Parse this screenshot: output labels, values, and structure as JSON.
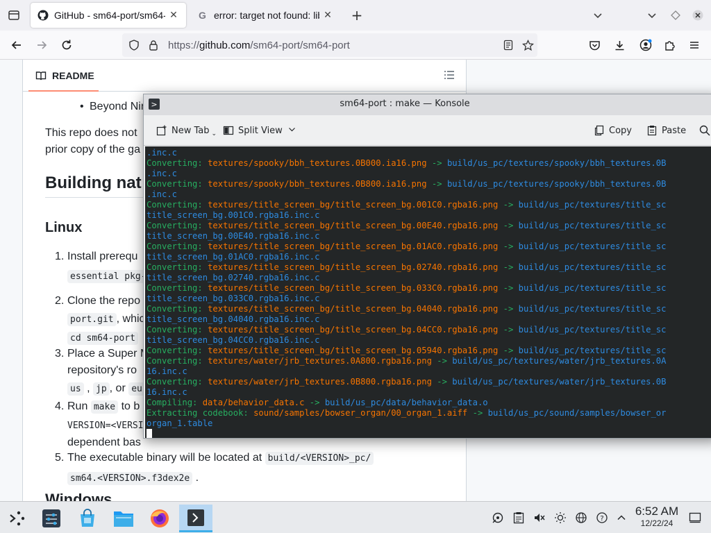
{
  "browser": {
    "tabs": [
      {
        "title": "GitHub - sm64-port/sm64-",
        "active": true,
        "favicon": "github-icon"
      },
      {
        "title": "error: target not found: lib",
        "active": false,
        "favicon": "google-icon"
      }
    ],
    "url_prefix": "https://",
    "url_host": "github.com",
    "url_path": "/sm64-port/sm64-port"
  },
  "readme": {
    "tab_label": "README",
    "bullet_item": "Beyond Ninten",
    "paragraph_line1": "This repo does not",
    "paragraph_line2": "prior copy of the ga",
    "heading_building": "Building nat",
    "heading_linux": "Linux",
    "list": [
      {
        "num": "1.",
        "line1": "Install prerequ",
        "code1": "essential pkg-"
      },
      {
        "num": "2.",
        "line1": "Clone the repo",
        "code1": "port.git",
        "line2_tail": ", whic",
        "code2": "cd sm64-port"
      },
      {
        "num": "3.",
        "line1": "Place a Super M",
        "line2": "repository's ro",
        "code_us": "us",
        "code_jp": "jp",
        "or_text": ", or",
        "code_eu": "eu"
      },
      {
        "num": "4.",
        "line1_pre": "Run",
        "code_make": "make",
        "line1_post": "to b",
        "code_ver": "VERSION=<VERSI",
        "line3": "dependent bas"
      },
      {
        "num": "5.",
        "line1": "The executable binary will be located at",
        "code_path1": "build/<VERSION>_pc/",
        "code_path2": "sm64.<VERSION>.f3dex2e",
        "period": "."
      }
    ],
    "heading_windows": "Windows"
  },
  "konsole": {
    "window_title": "sm64-port : make — Konsole",
    "toolbar": {
      "new_tab": "New Tab",
      "split_view": "Split View",
      "copy": "Copy",
      "paste": "Paste"
    },
    "lines": [
      [
        {
          "t": ".inc.c",
          "c": "blue"
        }
      ],
      [
        {
          "t": "Converting: ",
          "c": "green"
        },
        {
          "t": "textures/spooky/bbh_textures.0B000.ia16.png",
          "c": "orange"
        },
        {
          "t": " -> ",
          "c": "green"
        },
        {
          "t": "build/us_pc/textures/spooky/bbh_textures.0B",
          "c": "blue"
        }
      ],
      [
        {
          "t": ".inc.c",
          "c": "blue"
        }
      ],
      [
        {
          "t": "Converting: ",
          "c": "green"
        },
        {
          "t": "textures/spooky/bbh_textures.0B800.ia16.png",
          "c": "orange"
        },
        {
          "t": " -> ",
          "c": "green"
        },
        {
          "t": "build/us_pc/textures/spooky/bbh_textures.0B",
          "c": "blue"
        }
      ],
      [
        {
          "t": ".inc.c",
          "c": "blue"
        }
      ],
      [
        {
          "t": "Converting: ",
          "c": "green"
        },
        {
          "t": "textures/title_screen_bg/title_screen_bg.001C0.rgba16.png",
          "c": "orange"
        },
        {
          "t": " -> ",
          "c": "green"
        },
        {
          "t": "build/us_pc/textures/title_sc",
          "c": "blue"
        }
      ],
      [
        {
          "t": "title_screen_bg.001C0.rgba16.inc.c",
          "c": "blue"
        }
      ],
      [
        {
          "t": "Converting: ",
          "c": "green"
        },
        {
          "t": "textures/title_screen_bg/title_screen_bg.00E40.rgba16.png",
          "c": "orange"
        },
        {
          "t": " -> ",
          "c": "green"
        },
        {
          "t": "build/us_pc/textures/title_sc",
          "c": "blue"
        }
      ],
      [
        {
          "t": "title_screen_bg.00E40.rgba16.inc.c",
          "c": "blue"
        }
      ],
      [
        {
          "t": "Converting: ",
          "c": "green"
        },
        {
          "t": "textures/title_screen_bg/title_screen_bg.01AC0.rgba16.png",
          "c": "orange"
        },
        {
          "t": " -> ",
          "c": "green"
        },
        {
          "t": "build/us_pc/textures/title_sc",
          "c": "blue"
        }
      ],
      [
        {
          "t": "title_screen_bg.01AC0.rgba16.inc.c",
          "c": "blue"
        }
      ],
      [
        {
          "t": "Converting: ",
          "c": "green"
        },
        {
          "t": "textures/title_screen_bg/title_screen_bg.02740.rgba16.png",
          "c": "orange"
        },
        {
          "t": " -> ",
          "c": "green"
        },
        {
          "t": "build/us_pc/textures/title_sc",
          "c": "blue"
        }
      ],
      [
        {
          "t": "title_screen_bg.02740.rgba16.inc.c",
          "c": "blue"
        }
      ],
      [
        {
          "t": "Converting: ",
          "c": "green"
        },
        {
          "t": "textures/title_screen_bg/title_screen_bg.033C0.rgba16.png",
          "c": "orange"
        },
        {
          "t": " -> ",
          "c": "green"
        },
        {
          "t": "build/us_pc/textures/title_sc",
          "c": "blue"
        }
      ],
      [
        {
          "t": "title_screen_bg.033C0.rgba16.inc.c",
          "c": "blue"
        }
      ],
      [
        {
          "t": "Converting: ",
          "c": "green"
        },
        {
          "t": "textures/title_screen_bg/title_screen_bg.04040.rgba16.png",
          "c": "orange"
        },
        {
          "t": " -> ",
          "c": "green"
        },
        {
          "t": "build/us_pc/textures/title_sc",
          "c": "blue"
        }
      ],
      [
        {
          "t": "title_screen_bg.04040.rgba16.inc.c",
          "c": "blue"
        }
      ],
      [
        {
          "t": "Converting: ",
          "c": "green"
        },
        {
          "t": "textures/title_screen_bg/title_screen_bg.04CC0.rgba16.png",
          "c": "orange"
        },
        {
          "t": " -> ",
          "c": "green"
        },
        {
          "t": "build/us_pc/textures/title_sc",
          "c": "blue"
        }
      ],
      [
        {
          "t": "title_screen_bg.04CC0.rgba16.inc.c",
          "c": "blue"
        }
      ],
      [
        {
          "t": "Converting: ",
          "c": "green"
        },
        {
          "t": "textures/title_screen_bg/title_screen_bg.05940.rgba16.png",
          "c": "orange"
        },
        {
          "t": " -> ",
          "c": "green"
        },
        {
          "t": "build/us_pc/textures/title_sc",
          "c": "blue"
        }
      ],
      [
        {
          "t": "Converting: ",
          "c": "green"
        },
        {
          "t": "textures/water/jrb_textures.0A800.rgba16.png",
          "c": "orange"
        },
        {
          "t": " -> ",
          "c": "green"
        },
        {
          "t": "build/us_pc/textures/water/jrb_textures.0A",
          "c": "blue"
        }
      ],
      [
        {
          "t": "16.inc.c",
          "c": "blue"
        }
      ],
      [
        {
          "t": "Converting: ",
          "c": "green"
        },
        {
          "t": "textures/water/jrb_textures.0B800.rgba16.png",
          "c": "orange"
        },
        {
          "t": " -> ",
          "c": "green"
        },
        {
          "t": "build/us_pc/textures/water/jrb_textures.0B",
          "c": "blue"
        }
      ],
      [
        {
          "t": "16.inc.c",
          "c": "blue"
        }
      ],
      [
        {
          "t": "Compiling: ",
          "c": "green"
        },
        {
          "t": "data/behavior_data.c",
          "c": "orange"
        },
        {
          "t": " -> ",
          "c": "green"
        },
        {
          "t": "build/us_pc/data/behavior_data.o",
          "c": "blue"
        }
      ],
      [
        {
          "t": "Extracting codebook: ",
          "c": "green"
        },
        {
          "t": "sound/samples/bowser_organ/00_organ_1.aiff",
          "c": "orange"
        },
        {
          "t": " -> ",
          "c": "green"
        },
        {
          "t": "build/us_pc/sound/samples/bowser_or",
          "c": "blue"
        }
      ],
      [
        {
          "t": "organ_1.table",
          "c": "blue"
        }
      ]
    ]
  },
  "taskbar": {
    "time": "6:52 AM",
    "date": "12/22/24"
  },
  "colors": {
    "term_bg": "#232627",
    "term_green": "#27ae60",
    "term_orange": "#f67400",
    "term_blue": "#2e8be0",
    "accent": "#3daee9"
  }
}
